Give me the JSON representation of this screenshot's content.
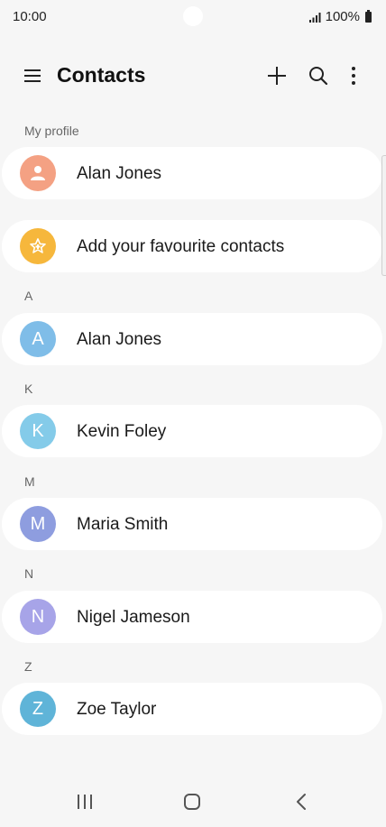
{
  "status": {
    "time": "10:00",
    "battery": "100%"
  },
  "app_bar": {
    "title": "Contacts"
  },
  "colors": {
    "background": "#f6f6f6",
    "card": "#ffffff",
    "avatar_profile": "#f4a183",
    "avatar_favourites": "#f6b73c",
    "avatar_a": "#7fbde8",
    "avatar_k": "#84cbe9",
    "avatar_m": "#8e9ddf",
    "avatar_n": "#a7a4e8",
    "avatar_z": "#5fb4d8"
  },
  "sections": {
    "my_profile": "My profile",
    "a": "A",
    "k": "K",
    "m": "M",
    "n": "N",
    "z": "Z"
  },
  "profile": {
    "name": "Alan Jones",
    "icon": "person-icon"
  },
  "favourites": {
    "label": "Add your favourite contacts",
    "icon": "star-icon"
  },
  "contacts": [
    {
      "initial": "A",
      "name": "Alan Jones"
    },
    {
      "initial": "K",
      "name": "Kevin Foley"
    },
    {
      "initial": "M",
      "name": "Maria Smith"
    },
    {
      "initial": "N",
      "name": "Nigel Jameson"
    },
    {
      "initial": "Z",
      "name": "Zoe Taylor"
    }
  ],
  "nav": {
    "icons": [
      "recent-apps-icon",
      "home-icon",
      "back-icon"
    ]
  }
}
